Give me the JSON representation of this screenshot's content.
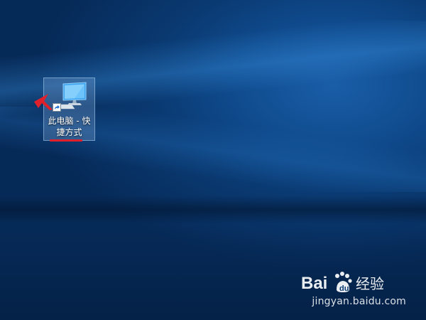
{
  "desktop": {
    "shortcut_icon": {
      "label_line1": "此电脑 - 快",
      "label_line2": "捷方式",
      "icon": "this-pc-computer-icon",
      "overlay_icon": "shortcut-arrow-icon"
    }
  },
  "annotations": {
    "arrow_color": "#e0202a",
    "underline_color": "#e0202a"
  },
  "watermark": {
    "logo_text": "Bai经验",
    "logo_icon": "baidu-paw-icon",
    "url": "jingyan.baidu.com"
  },
  "colors": {
    "wallpaper_base": "#0a3a72",
    "wallpaper_light": "#1a5ea8",
    "selection_fill": "#8cb4e1"
  }
}
